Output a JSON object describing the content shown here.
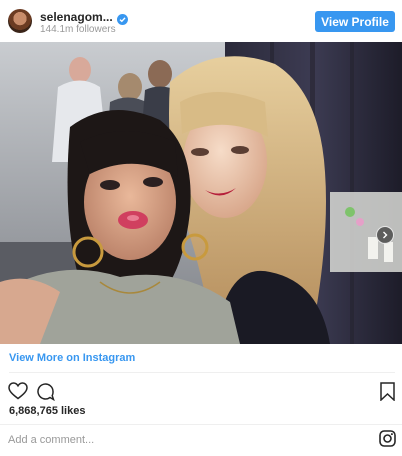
{
  "header": {
    "username": "selenagom...",
    "followers": "144.1m followers",
    "view_profile_label": "View Profile",
    "verified_icon": "verified-badge-icon",
    "accent_color": "#3897f0"
  },
  "post": {
    "image_icon": "photo",
    "carousel_icon": "chevron-right-icon"
  },
  "footer": {
    "view_more_label": "View More on Instagram",
    "likes": "6,868,765 likes",
    "comment_placeholder": "Add a comment...",
    "icons": [
      "heart-icon",
      "comment-icon",
      "bookmark-icon",
      "instagram-icon"
    ]
  }
}
